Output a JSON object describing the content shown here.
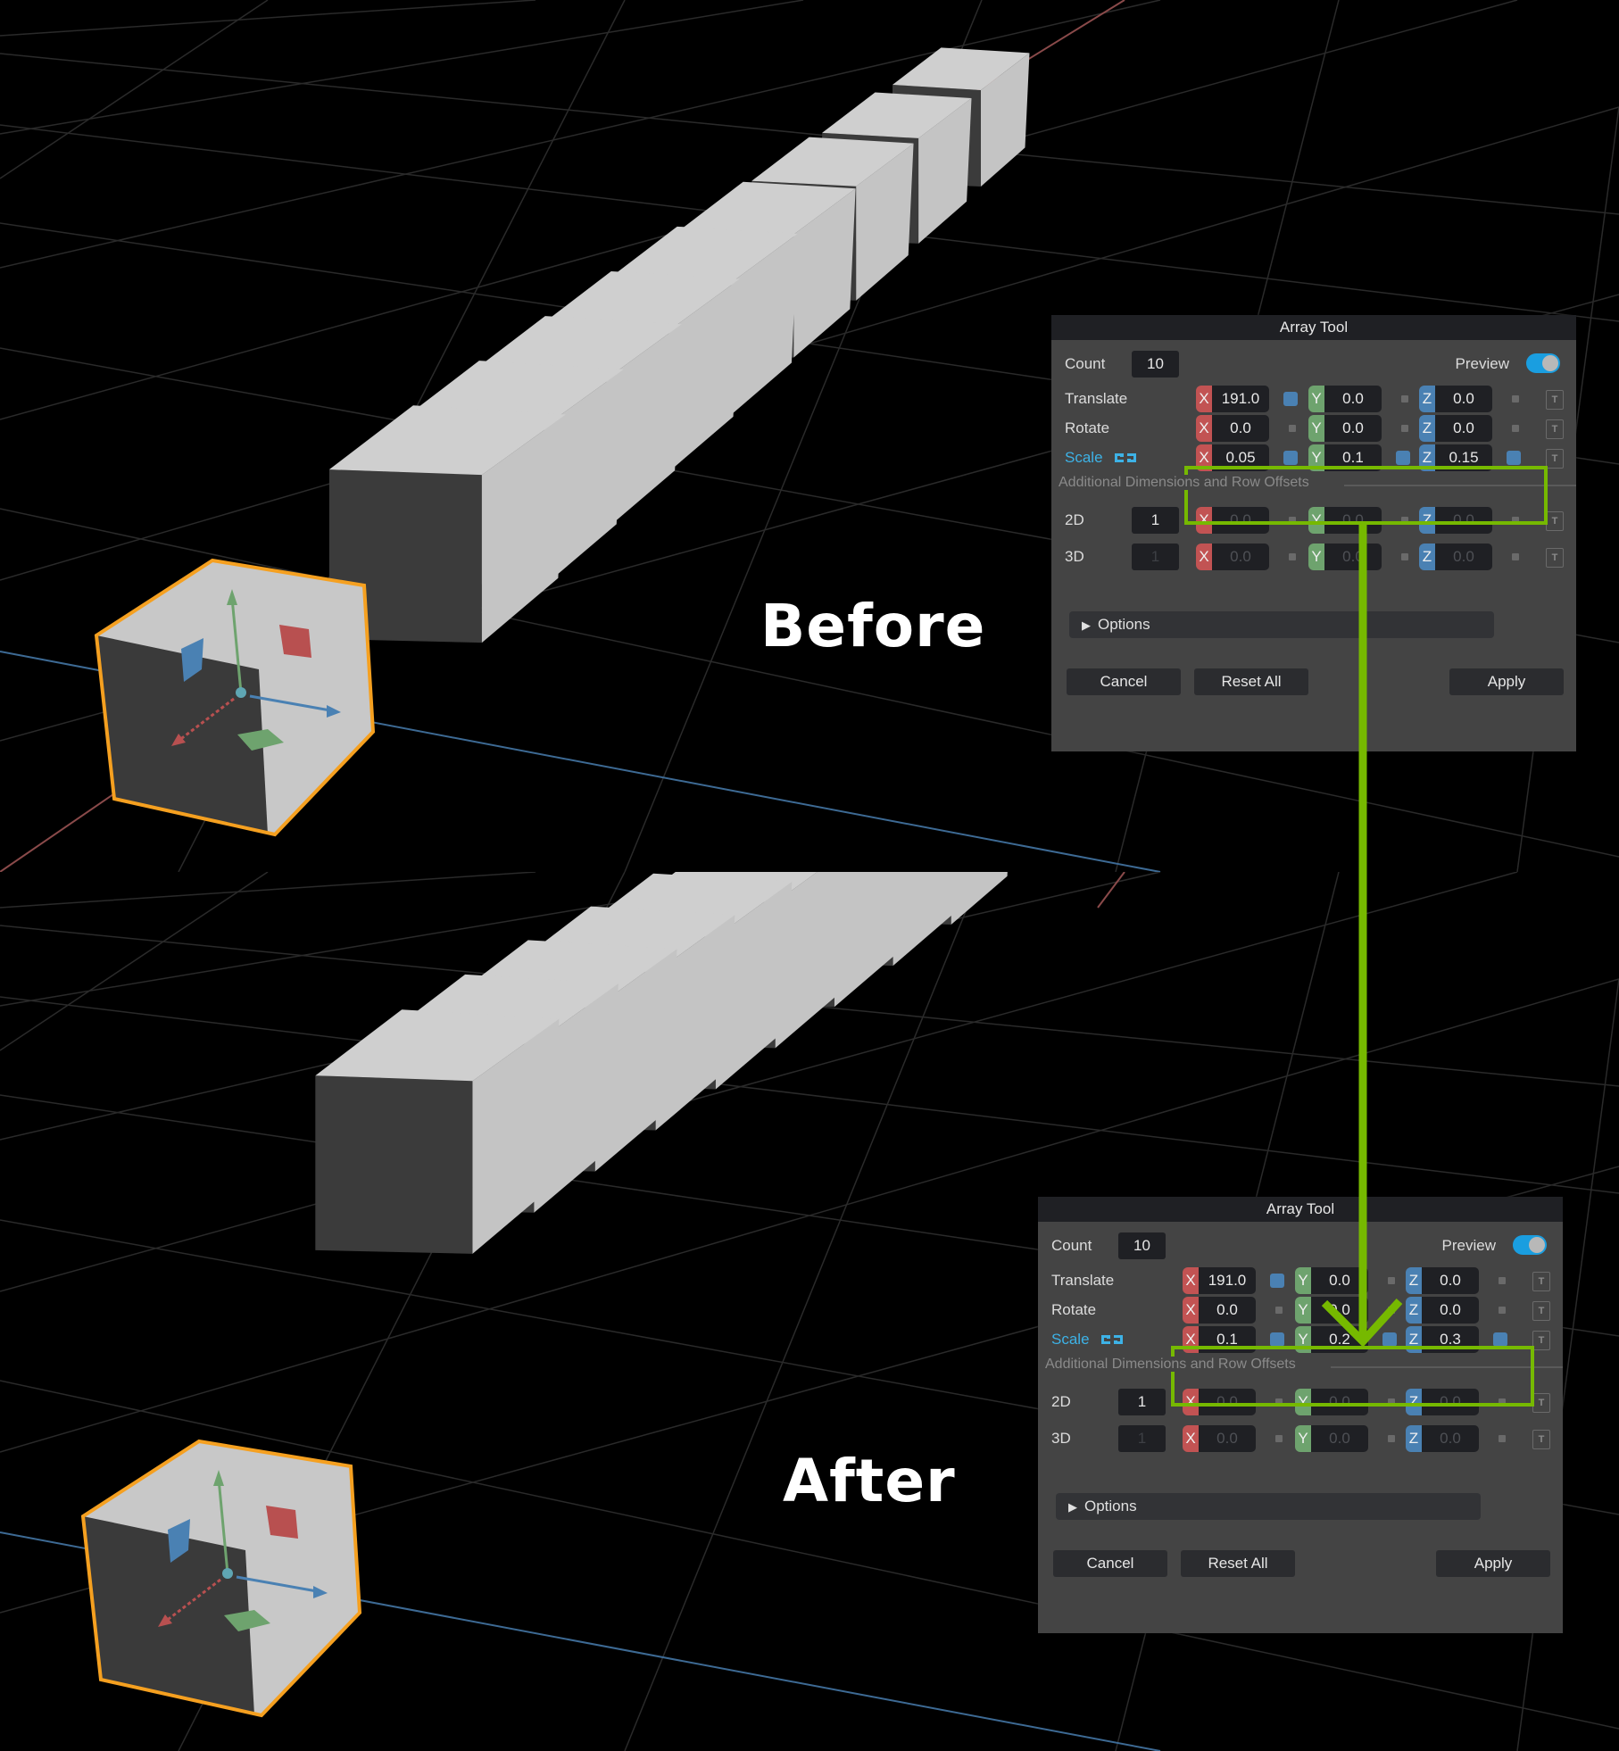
{
  "captions": {
    "before": "Before",
    "after": "After"
  },
  "colors": {
    "highlight": "#76b900",
    "selection": "#f5a020",
    "accent": "#3db2e6",
    "axis_x": "#c25353",
    "axis_y": "#6ea36e",
    "axis_z": "#4a81b3"
  },
  "panels": [
    {
      "title": "Array Tool",
      "count_label": "Count",
      "count": "10",
      "preview_label": "Preview",
      "preview_on": true,
      "translate": {
        "label": "Translate",
        "x": "191.0",
        "y": "0.0",
        "z": "0.0"
      },
      "rotate": {
        "label": "Rotate",
        "x": "0.0",
        "y": "0.0",
        "z": "0.0"
      },
      "scale": {
        "label": "Scale",
        "x": "0.05",
        "y": "0.1",
        "z": "0.15"
      },
      "section_label": "Additional Dimensions and Row Offsets",
      "dim2": {
        "label": "2D",
        "count": "1",
        "x": "0.0",
        "y": "0.0",
        "z": "0.0"
      },
      "dim3": {
        "label": "3D",
        "count": "1",
        "x": "0.0",
        "y": "0.0",
        "z": "0.0"
      },
      "options_label": "Options",
      "cancel": "Cancel",
      "reset": "Reset All",
      "apply": "Apply",
      "axis_labels": {
        "x": "X",
        "y": "Y",
        "z": "Z"
      },
      "t_icon": "T"
    },
    {
      "title": "Array Tool",
      "count_label": "Count",
      "count": "10",
      "preview_label": "Preview",
      "preview_on": true,
      "translate": {
        "label": "Translate",
        "x": "191.0",
        "y": "0.0",
        "z": "0.0"
      },
      "rotate": {
        "label": "Rotate",
        "x": "0.0",
        "y": "0.0",
        "z": "0.0"
      },
      "scale": {
        "label": "Scale",
        "x": "0.1",
        "y": "0.2",
        "z": "0.3"
      },
      "section_label": "Additional Dimensions and Row Offsets",
      "dim2": {
        "label": "2D",
        "count": "1",
        "x": "0.0",
        "y": "0.0",
        "z": "0.0"
      },
      "dim3": {
        "label": "3D",
        "count": "1",
        "x": "0.0",
        "y": "0.0",
        "z": "0.0"
      },
      "options_label": "Options",
      "cancel": "Cancel",
      "reset": "Reset All",
      "apply": "Apply",
      "axis_labels": {
        "x": "X",
        "y": "Y",
        "z": "Z"
      },
      "t_icon": "T"
    }
  ]
}
